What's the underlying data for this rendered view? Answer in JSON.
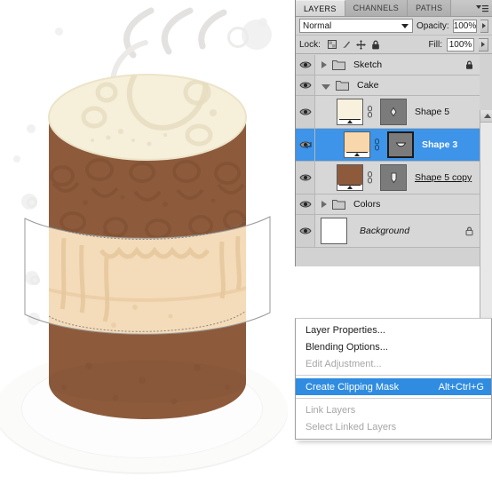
{
  "app": {
    "name": "Adobe Photoshop Layers Panel"
  },
  "panel": {
    "tabs": [
      {
        "label": "LAYERS",
        "active": true
      },
      {
        "label": "CHANNELS",
        "active": false
      },
      {
        "label": "PATHS",
        "active": false
      }
    ],
    "menu_icon": "panel-menu-icon",
    "blend_mode": "Normal",
    "opacity_label": "Opacity:",
    "opacity_value": "100%",
    "lock_label": "Lock:",
    "lock_icons": [
      "lock-transparent-pixels-icon",
      "lock-image-pixels-icon",
      "lock-position-icon",
      "lock-all-icon"
    ],
    "fill_label": "Fill:",
    "fill_value": "100%",
    "scrollbar": {
      "up_arrow": "scroll-up-arrow-icon"
    },
    "layers": [
      {
        "name": "Sketch",
        "type": "group",
        "expanded": false,
        "visible": true,
        "locked": true,
        "selected": false,
        "indent": 0
      },
      {
        "name": "Cake",
        "type": "group",
        "expanded": true,
        "visible": true,
        "locked": false,
        "selected": false,
        "indent": 0
      },
      {
        "name": "Shape 5",
        "type": "shape",
        "visible": true,
        "selected": false,
        "indent": 1,
        "thumb_color": "#f7f1dd",
        "mask_selected": false,
        "clipped": false,
        "linked": true
      },
      {
        "name": "Shape 3",
        "type": "shape",
        "visible": true,
        "selected": true,
        "indent": 1,
        "thumb_color": "#f7d7ab",
        "mask_selected": true,
        "clipped": true,
        "linked": true
      },
      {
        "name": "Shape 5 copy",
        "type": "shape",
        "visible": true,
        "selected": false,
        "indent": 1,
        "thumb_color": "#8d5b3c",
        "mask_selected": false,
        "clipped": false,
        "linked": true,
        "underlined": true
      },
      {
        "name": "Colors",
        "type": "group",
        "expanded": false,
        "visible": true,
        "locked": false,
        "selected": false,
        "indent": 0
      },
      {
        "name": "Background",
        "type": "raster",
        "visible": true,
        "locked": true,
        "selected": false,
        "indent": 0,
        "italic": true,
        "thumb_color": "#ffffff"
      }
    ]
  },
  "context_menu": {
    "items": [
      {
        "label": "Layer Properties...",
        "shortcut": "",
        "state": "normal"
      },
      {
        "label": "Blending Options...",
        "shortcut": "",
        "state": "normal"
      },
      {
        "label": "Edit Adjustment...",
        "shortcut": "",
        "state": "disabled"
      },
      {
        "separator": true
      },
      {
        "label": "Create Clipping Mask",
        "shortcut": "Alt+Ctrl+G",
        "state": "highlighted"
      },
      {
        "separator": true
      },
      {
        "label": "Link Layers",
        "shortcut": "",
        "state": "disabled"
      },
      {
        "label": "Select Linked Layers",
        "shortcut": "",
        "state": "disabled"
      }
    ]
  },
  "artwork": {
    "title": "chocolate-cake-illustration",
    "colors": {
      "canvas_background": "#ffffff",
      "cake_brown": "#8d5b3c",
      "cake_brown_shadow": "#7d4f33",
      "cream_top": "#f6efda",
      "cream_top_edge": "#ece4c9",
      "icing_band": "#f4dcba",
      "icing_drip": "#e6c79d",
      "plate_white": "#fbfbfa",
      "bg_decor": "#f0efee",
      "path_outline": "#9a9a9a"
    }
  }
}
